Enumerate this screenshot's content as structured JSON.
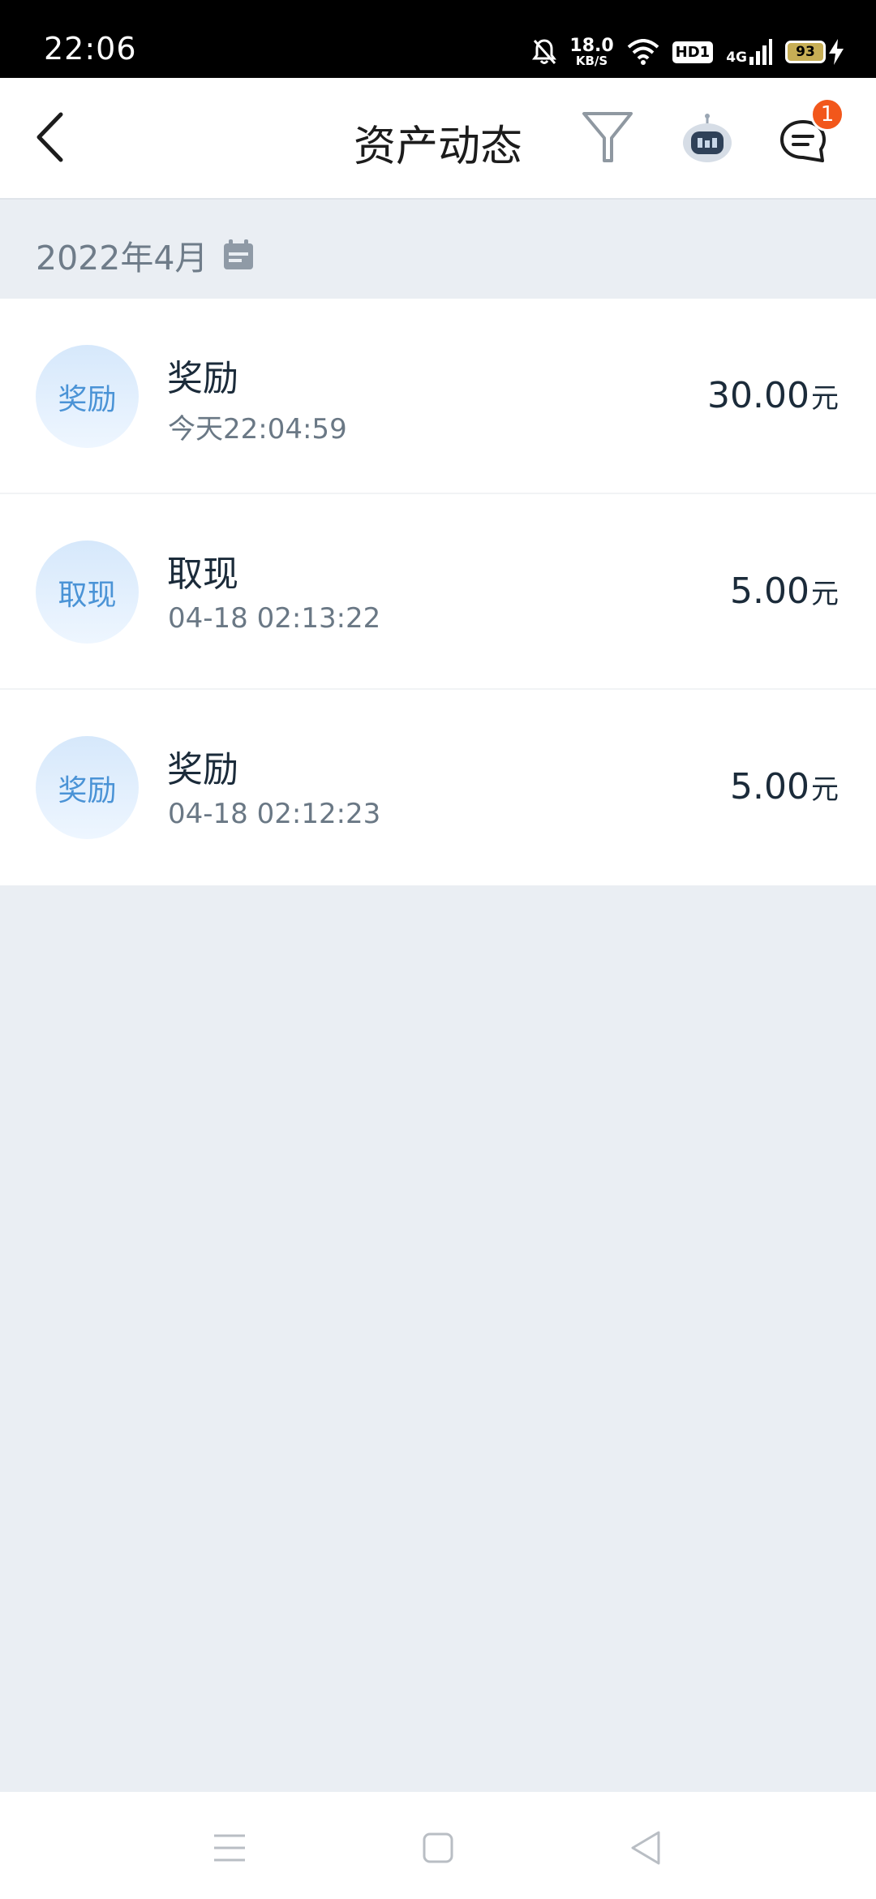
{
  "status_bar": {
    "time": "22:06",
    "net_speed_value": "18.0",
    "net_speed_unit": "KB/S",
    "hd_label": "HD1",
    "network_label": "4G",
    "battery": "93",
    "icons": [
      "bell-off-icon",
      "wifi-icon",
      "signal-icon",
      "charging-icon"
    ]
  },
  "header": {
    "title": "资产动态",
    "icons": [
      "back-arrow-icon",
      "filter-icon",
      "robot-assistant-icon",
      "message-icon"
    ],
    "message_badge": "1"
  },
  "month_bar": {
    "label": "2022年4月",
    "icon": "calendar-icon"
  },
  "transactions": [
    {
      "avatar_text": "奖励",
      "title": "奖励",
      "time": "今天22:04:59",
      "amount": "30.00",
      "unit": "元"
    },
    {
      "avatar_text": "取现",
      "title": "取现",
      "time": "04-18 02:13:22",
      "amount": "5.00",
      "unit": "元"
    },
    {
      "avatar_text": "奖励",
      "title": "奖励",
      "time": "04-18 02:12:23",
      "amount": "5.00",
      "unit": "元"
    }
  ],
  "nav_bar": {
    "icons": [
      "menu-icon",
      "home-icon",
      "back-icon"
    ]
  },
  "colors": {
    "page_background": "#eaeef3",
    "avatar_text": "#4a93d6",
    "badge": "#f2571b",
    "primary_text": "#1b2b3a",
    "secondary_text": "#6a7885"
  }
}
